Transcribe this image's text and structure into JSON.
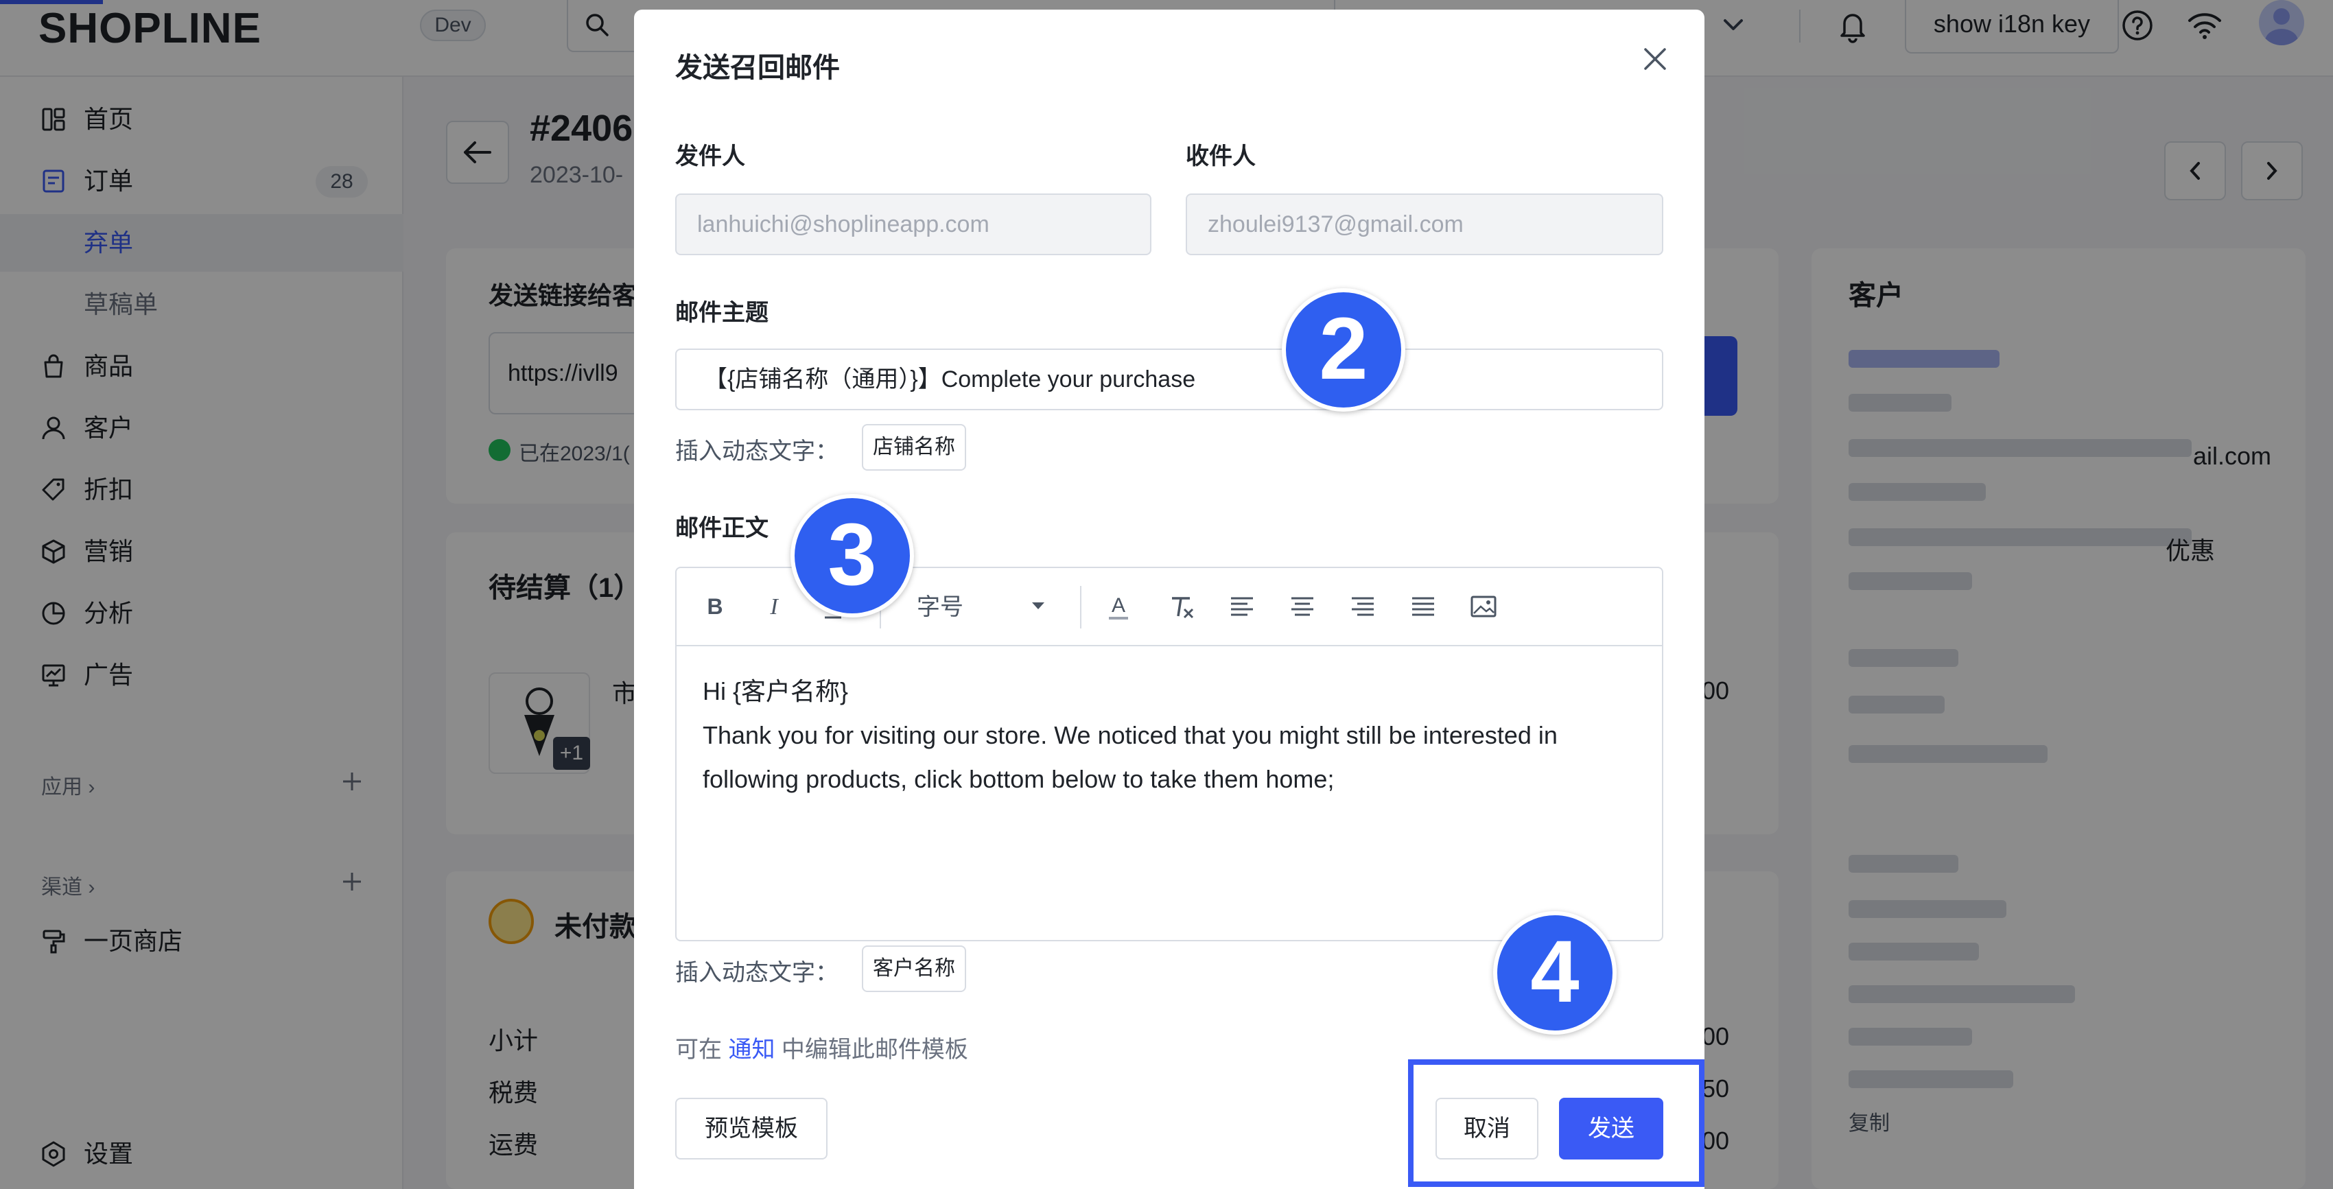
{
  "topbar": {
    "logo": "SHOPLINE",
    "env": "Dev",
    "i18n_button": "show i18n key"
  },
  "sidebar": {
    "items": [
      {
        "label": "首页",
        "icon": "dashboard-icon"
      },
      {
        "label": "订单",
        "icon": "order-icon",
        "badge": "28"
      },
      {
        "label": "弃单",
        "sub": true,
        "active": true
      },
      {
        "label": "草稿单",
        "sub": true
      },
      {
        "label": "商品",
        "icon": "bag-icon"
      },
      {
        "label": "客户",
        "icon": "user-icon"
      },
      {
        "label": "折扣",
        "icon": "tag-icon"
      },
      {
        "label": "营销",
        "icon": "box-icon"
      },
      {
        "label": "分析",
        "icon": "pie-icon"
      },
      {
        "label": "广告",
        "icon": "ad-icon"
      }
    ],
    "apps_label": "应用 ›",
    "channels_label": "渠道 ›",
    "store_item": "一页商店",
    "settings": "设置"
  },
  "main": {
    "order_number": "#2406",
    "order_date": "2023-10-",
    "send_link_label": "发送链接给客",
    "link_value": "https://ivll9",
    "sent_status": "已在2023/1(",
    "pending_title": "待结算（1）",
    "product_name_fragment": "市",
    "product_more": "+1",
    "unpaid_title": "未付款",
    "summary": [
      {
        "label": "小计",
        "value": ".00"
      },
      {
        "label": "税费",
        "value": ".50"
      },
      {
        "label": "运费",
        "value": ".00"
      }
    ],
    "product_price": ".00",
    "customer_title": "客户",
    "customer_email_fragment": "ail.com",
    "customer_discount_fragment": "优惠",
    "copy_label": "复制"
  },
  "modal": {
    "title": "发送召回邮件",
    "sender_label": "发件人",
    "sender_value": "lanhuichi@shoplineapp.com",
    "recipient_label": "收件人",
    "recipient_value": "zhoulei9137@gmail.com",
    "subject_label": "邮件主题",
    "subject_value": "【{店铺名称（通用）}】Complete your purchase",
    "insert_label_1": "插入动态文字：",
    "insert_tag_1": "店铺名称",
    "body_label": "邮件正文",
    "font_size_placeholder": "字号",
    "body_line_1": "Hi  {客户名称}",
    "body_line_2": "Thank you for visiting our store. We noticed that you might still be interested in",
    "body_line_3": "following products, click bottom below to take them home;",
    "insert_label_2": "插入动态文字：",
    "insert_tag_2": "客户名称",
    "notice_prefix": "可在 ",
    "notice_link": "通知",
    "notice_suffix": " 中编辑此邮件模板",
    "preview_button": "预览模板",
    "cancel_button": "取消",
    "send_button": "发送"
  },
  "steps": [
    "2",
    "3",
    "4"
  ],
  "colors": {
    "primary": "#3a5af5",
    "step_badge": "#2f5ff0",
    "overlay": "rgba(0,0,0,0.45)"
  }
}
